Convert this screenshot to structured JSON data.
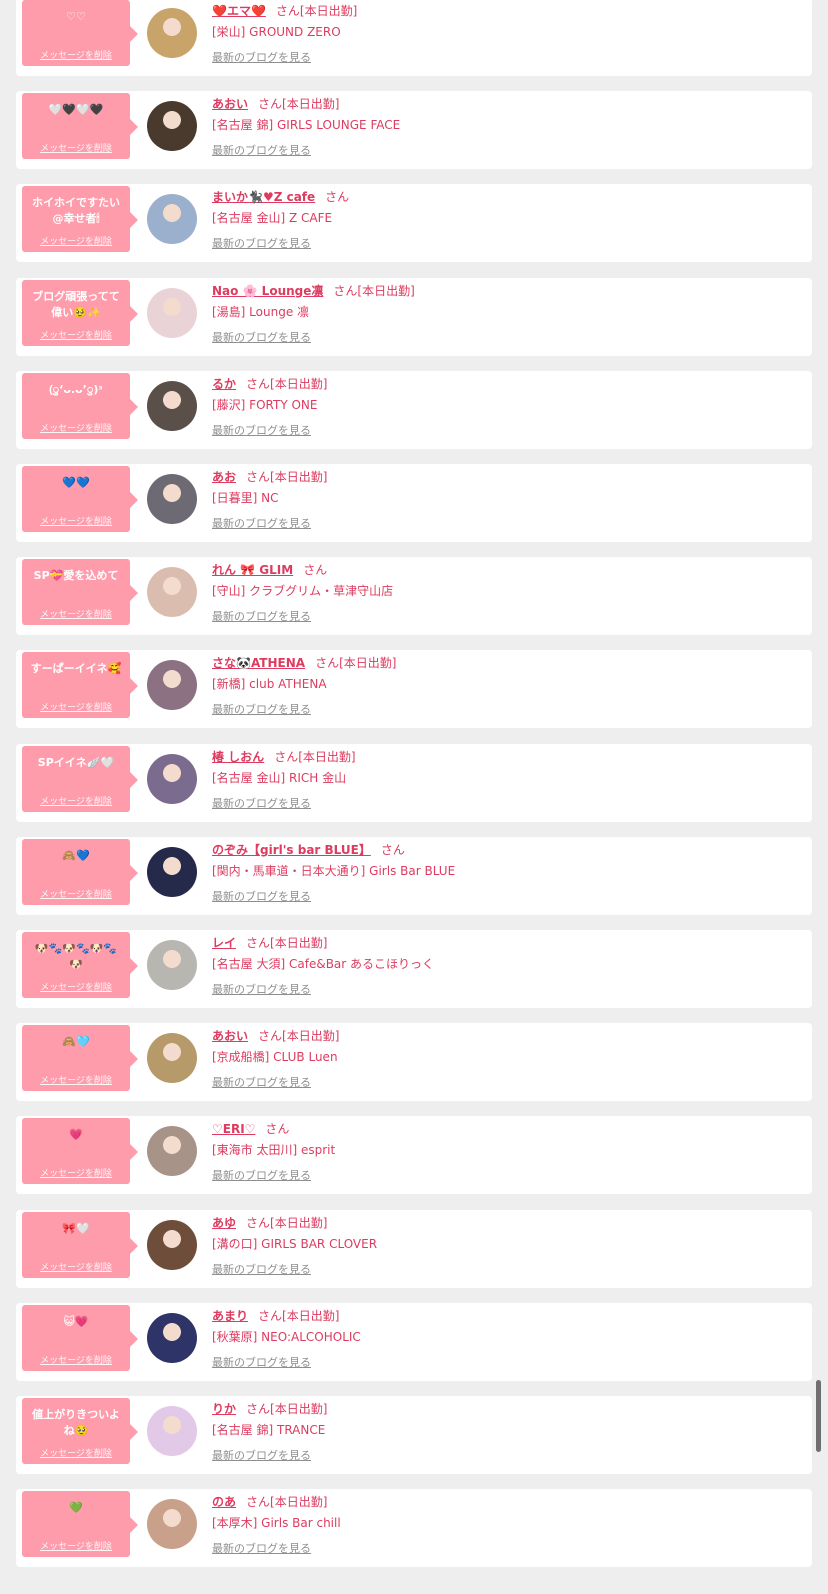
{
  "labels": {
    "delete_message": "メッセージを削除",
    "latest_blog": "最新のブログを見る",
    "honorific": "さん",
    "on_duty_today": "[本日出勤]"
  },
  "colors": {
    "bubble": "#ff9cac",
    "text_accent": "#dd3b5f",
    "link_gray": "#8f8f8f",
    "page_bg": "#eeeeee"
  },
  "entries": [
    {
      "message": "♡♡",
      "name": "❤️エマ❤️",
      "on_duty": true,
      "shop": "[栄山] GROUND ZERO",
      "avatar_color": "#c9a46a"
    },
    {
      "message": "🤍🖤🤍🖤",
      "name": "あおい",
      "on_duty": true,
      "shop": "[名古屋 錦] GIRLS LOUNGE FACE",
      "avatar_color": "#4a3a2e"
    },
    {
      "message": "ホイホイですたい\n@幸せ者🕯",
      "name": "まいか🐈‍⬛♥Z cafe",
      "on_duty": false,
      "shop": "[名古屋 金山] Z CAFE",
      "avatar_color": "#9ab0cc"
    },
    {
      "message": "ブログ頑張ってて\n偉い🥹✨",
      "name": "Nao 🌸 Lounge凛",
      "on_duty": true,
      "shop": "[湯島] Lounge 凛",
      "avatar_color": "#ead3d6"
    },
    {
      "message": "(ु‘ᴗ.ᴗ’ु)ᵌ",
      "name": "るか",
      "on_duty": true,
      "shop": "[藤沢] FORTY ONE",
      "avatar_color": "#5b4f49"
    },
    {
      "message": "💙💙",
      "name": "あお",
      "on_duty": true,
      "shop": "[日暮里] NC",
      "avatar_color": "#6d6a74"
    },
    {
      "message": "SP💝愛を込めて",
      "name": "れん 🎀 GLIM",
      "on_duty": false,
      "shop": "[守山] クラブグリム・草津守山店",
      "avatar_color": "#dbbdb0"
    },
    {
      "message": "すーぱーイイネ🥰",
      "name": "さな🐼ATHENA",
      "on_duty": true,
      "shop": "[新橋] club ATHENA",
      "avatar_color": "#8b7181"
    },
    {
      "message": "SPイイネ🪽🤍",
      "name": "椿 しおん",
      "on_duty": true,
      "shop": "[名古屋 金山] RICH 金山",
      "avatar_color": "#7b6b8f"
    },
    {
      "message": "🙈💙",
      "name": "のぞみ【girl's bar BLUE】",
      "on_duty": false,
      "shop": "[関内・馬車道・日本大通り] Girls Bar BLUE",
      "avatar_color": "#262a4a"
    },
    {
      "message": "🐶🐾🐶🐾🐶🐾\n🐶",
      "name": "レイ",
      "on_duty": true,
      "shop": "[名古屋 大須] Cafe&Bar あるこほりっく",
      "avatar_color": "#b8b6b1"
    },
    {
      "message": "🙈🩵",
      "name": "あおい",
      "on_duty": true,
      "shop": "[京成船橋] CLUB Luen",
      "avatar_color": "#b79a6a"
    },
    {
      "message": "💗",
      "name": "♡ERI♡",
      "on_duty": false,
      "shop": "[東海市 太田川] esprit",
      "avatar_color": "#a89389"
    },
    {
      "message": "🎀🤍",
      "name": "あゆ",
      "on_duty": true,
      "shop": "[溝の口] GIRLS BAR CLOVER",
      "avatar_color": "#6e4e3a"
    },
    {
      "message": "😺💗",
      "name": "あまり",
      "on_duty": true,
      "shop": "[秋葉原] NEO:ALCOHOLIC",
      "avatar_color": "#2f3468"
    },
    {
      "message": "値上がりきついよ\nね🥹",
      "name": "りか",
      "on_duty": true,
      "shop": "[名古屋 錦] TRANCE",
      "avatar_color": "#e3c9e8"
    },
    {
      "message": "💚",
      "name": "のあ",
      "on_duty": true,
      "shop": "[本厚木] Girls Bar chill",
      "avatar_color": "#c9a08a"
    }
  ]
}
